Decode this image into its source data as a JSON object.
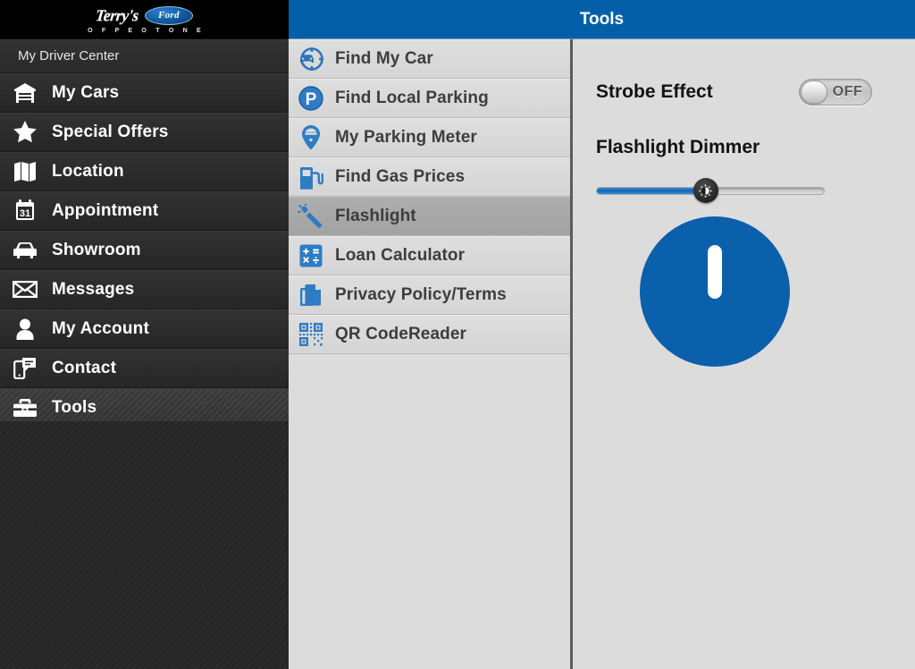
{
  "brand": {
    "name": "Terry's",
    "oval_text": "Ford",
    "subtitle": "O F   P E O T O N E"
  },
  "sidebar": {
    "section_label": "My Driver Center",
    "items": [
      {
        "label": "My Cars",
        "icon": "garage-icon",
        "active": false
      },
      {
        "label": "Special Offers",
        "icon": "star-icon",
        "active": false
      },
      {
        "label": "Location",
        "icon": "map-icon",
        "active": false
      },
      {
        "label": "Appointment",
        "icon": "calendar-icon",
        "active": false
      },
      {
        "label": "Showroom",
        "icon": "car-front-icon",
        "active": false
      },
      {
        "label": "Messages",
        "icon": "envelope-icon",
        "active": false
      },
      {
        "label": "My Account",
        "icon": "person-icon",
        "active": false
      },
      {
        "label": "Contact",
        "icon": "phone-chat-icon",
        "active": false
      },
      {
        "label": "Tools",
        "icon": "toolbox-icon",
        "active": true
      }
    ]
  },
  "header": {
    "title": "Tools"
  },
  "tools_list": {
    "items": [
      {
        "label": "Find My Car",
        "icon": "car-locate-icon",
        "selected": false
      },
      {
        "label": "Find Local Parking",
        "icon": "parking-p-icon",
        "selected": false
      },
      {
        "label": "My Parking Meter",
        "icon": "parking-meter-icon",
        "selected": false
      },
      {
        "label": "Find Gas Prices",
        "icon": "gas-pump-icon",
        "selected": false
      },
      {
        "label": "Flashlight",
        "icon": "flashlight-icon",
        "selected": true
      },
      {
        "label": "Loan Calculator",
        "icon": "calculator-icon",
        "selected": false
      },
      {
        "label": "Privacy Policy/Terms",
        "icon": "documents-icon",
        "selected": false
      },
      {
        "label": "QR CodeReader",
        "icon": "qr-code-icon",
        "selected": false
      }
    ]
  },
  "detail": {
    "strobe_label": "Strobe Effect",
    "strobe_state": "OFF",
    "dimmer_label": "Flashlight Dimmer",
    "dimmer_percent": 48,
    "power_button_name": "flashlight-power-button"
  },
  "colors": {
    "header_blue": "#0360a8",
    "power_blue": "#0a60ab",
    "sidebar_dark": "#2b2b2b",
    "panel_gray": "#dcdcdc",
    "selected_gray": "#a8a8a8",
    "slider_blue": "#1464b4"
  }
}
